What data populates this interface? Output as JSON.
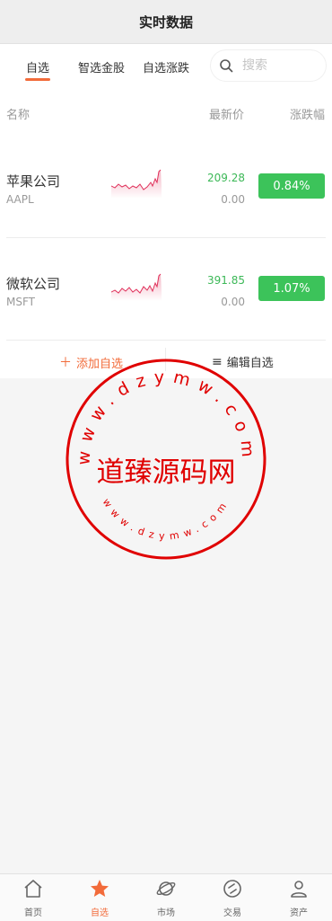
{
  "header": {
    "title": "实时数据"
  },
  "tabs": [
    {
      "label": "自选",
      "active": true
    },
    {
      "label": "智选金股",
      "active": false
    },
    {
      "label": "自选涨跌",
      "active": false
    }
  ],
  "search": {
    "placeholder": "搜索",
    "value": ""
  },
  "columns": {
    "name": "名称",
    "price": "最新价",
    "pct": "涨跌幅"
  },
  "stocks": [
    {
      "name": "苹果公司",
      "code": "AAPL",
      "price": "209.28",
      "change": "0.00",
      "pct": "0.84%"
    },
    {
      "name": "微软公司",
      "code": "MSFT",
      "price": "391.85",
      "change": "0.00",
      "pct": "1.07%"
    }
  ],
  "actions": {
    "add": "添加自选",
    "edit": "编辑自选"
  },
  "watermark": {
    "text": "道臻源码网",
    "url": "www.dzymw.com"
  },
  "tabbar": [
    {
      "label": "首页",
      "icon": "home-icon",
      "active": false
    },
    {
      "label": "自选",
      "icon": "star-icon",
      "active": true
    },
    {
      "label": "市场",
      "icon": "planet-icon",
      "active": false
    },
    {
      "label": "交易",
      "icon": "trade-icon",
      "active": false
    },
    {
      "label": "资产",
      "icon": "user-icon",
      "active": false
    }
  ],
  "colors": {
    "accent": "#f26b3a",
    "rise_badge": "#3cc35a",
    "price_green": "#3cb857",
    "spark_line": "#e0305a",
    "stamp_red": "#e00000"
  }
}
